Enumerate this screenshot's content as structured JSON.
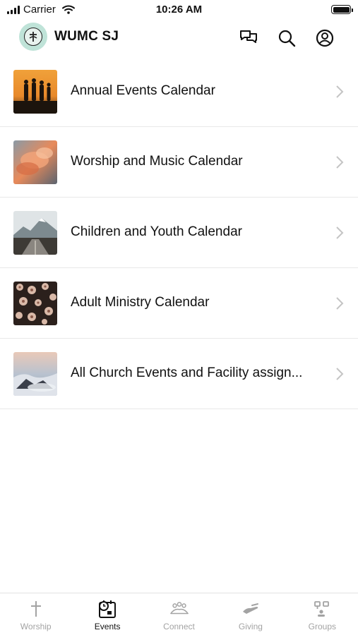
{
  "status_bar": {
    "carrier": "Carrier",
    "time": "10:26 AM"
  },
  "header": {
    "title": "WUMC SJ",
    "icons": [
      "chat-icon",
      "search-icon",
      "profile-icon"
    ]
  },
  "calendars": [
    {
      "label": "Annual Events Calendar",
      "thumb": "sunset-silhouettes"
    },
    {
      "label": "Worship and Music Calendar",
      "thumb": "orange-clouds"
    },
    {
      "label": "Children and Youth Calendar",
      "thumb": "mountain-road"
    },
    {
      "label": "Adult Ministry Calendar",
      "thumb": "flower-pattern"
    },
    {
      "label": "All Church Events and Facility assign...",
      "thumb": "misty-mountains"
    }
  ],
  "tabs": [
    {
      "label": "Worship",
      "icon": "cross-icon",
      "active": false
    },
    {
      "label": "Events",
      "icon": "calendar-clock-icon",
      "active": true
    },
    {
      "label": "Connect",
      "icon": "people-icon",
      "active": false
    },
    {
      "label": "Giving",
      "icon": "hand-icon",
      "active": false
    },
    {
      "label": "Groups",
      "icon": "groups-icon",
      "active": false
    }
  ],
  "colors": {
    "logo_bg": "#bfe3d8",
    "tab_inactive": "#a3a3a3",
    "tab_active": "#111111",
    "divider": "#e8e8e8"
  }
}
